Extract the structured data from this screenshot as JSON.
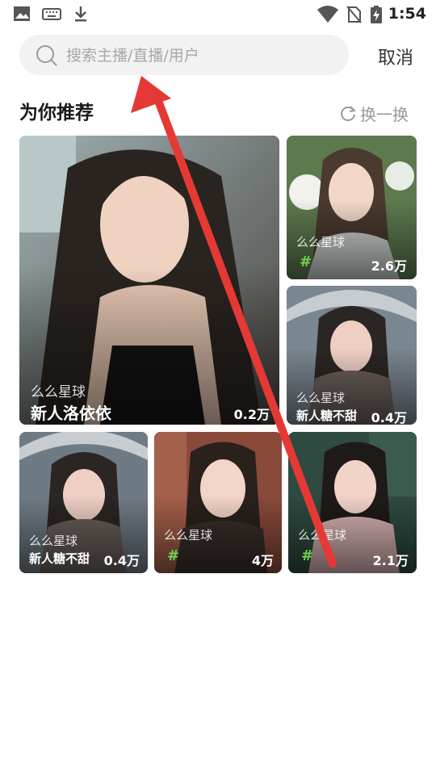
{
  "status_bar": {
    "time": "1:54",
    "icons": [
      "image-icon",
      "keyboard-icon",
      "download-icon",
      "wifi-icon",
      "no-sim-icon",
      "battery-charging-icon"
    ]
  },
  "search": {
    "placeholder": "搜索主播/直播/用户",
    "value": "",
    "cancel_label": "取消"
  },
  "recommend": {
    "title": "为你推荐",
    "refresh_label": "换一换"
  },
  "cards": [
    {
      "tag": "么么星球",
      "name": "新人洛依依",
      "count": "0.2万"
    },
    {
      "tag": "么么星球",
      "name": "",
      "count": "2.6万",
      "hash": "#"
    },
    {
      "tag": "么么星球",
      "name": "新人糖不甜",
      "count": "0.4万"
    },
    {
      "tag": "么么星球",
      "name": "新人糖不甜",
      "count": "0.4万"
    },
    {
      "tag": "么么星球",
      "name": "",
      "count": "4万",
      "hash": "#"
    },
    {
      "tag": "么么星球",
      "name": "",
      "count": "2.1万",
      "hash": "#"
    }
  ],
  "colors": {
    "hash_green": "#6fd34f",
    "annotation_arrow": "#e53935"
  }
}
